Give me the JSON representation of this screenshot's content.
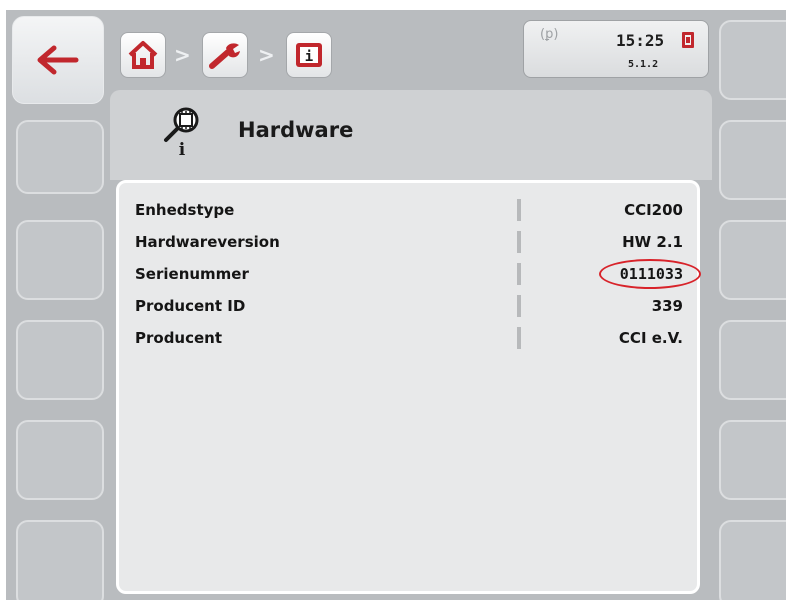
{
  "header": {
    "breadcrumb": [
      {
        "icon": "home-icon"
      },
      {
        "separator": ">"
      },
      {
        "icon": "wrench-icon"
      },
      {
        "separator": ">"
      },
      {
        "icon": "info-terminal-icon"
      }
    ],
    "status": {
      "time": "15:25",
      "version": "5.1.2",
      "signal_glyph": "(ꝑ)"
    }
  },
  "page": {
    "title": "Hardware",
    "title_icon": "hardware-info-icon"
  },
  "rows": [
    {
      "label": "Enhedstype",
      "value": "CCI200"
    },
    {
      "label": "Hardwareversion",
      "value": "HW 2.1"
    },
    {
      "label": "Serienummer",
      "value": "0111033"
    },
    {
      "label": "Producent ID",
      "value": "339"
    },
    {
      "label": "Producent",
      "value": "CCI e.V."
    }
  ],
  "colors": {
    "accent": "#c1272d",
    "background": "#b9bcbf",
    "highlight": "#d8232a"
  }
}
